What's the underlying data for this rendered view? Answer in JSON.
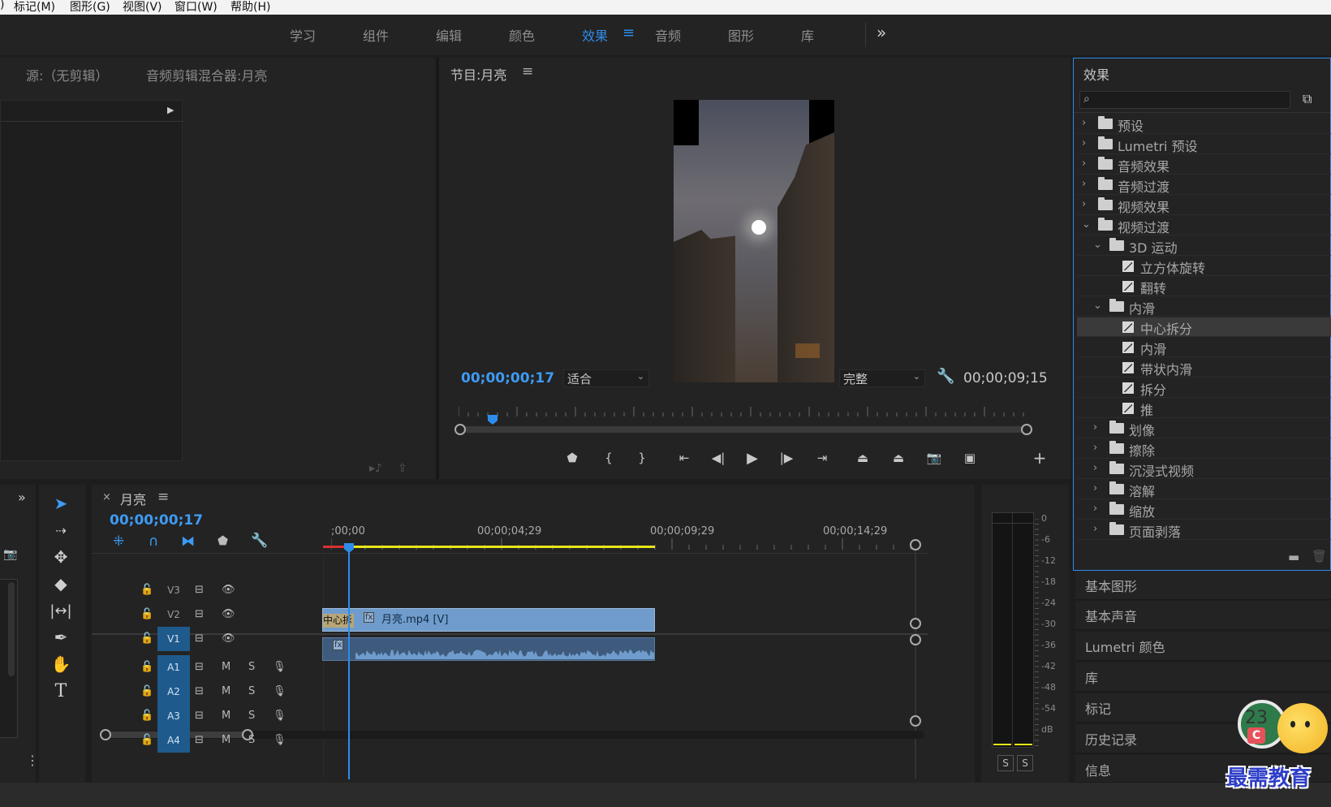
{
  "menu": {
    "items": [
      ")",
      "标记(M)",
      "图形(G)",
      "视图(V)",
      "窗口(W)",
      "帮助(H)"
    ]
  },
  "workspaces": {
    "tabs": [
      "学习",
      "组件",
      "编辑",
      "颜色",
      "效果",
      "音频",
      "图形",
      "库"
    ],
    "active": "效果",
    "more": "»"
  },
  "source_panel": {
    "tab_source": "源:（无剪辑）",
    "tab_mixer": "音频剪辑混合器:月亮"
  },
  "program": {
    "title": "节目:月亮",
    "timecode_current": "00;00;00;17",
    "fit_value": "适合",
    "quality_value": "完整",
    "timecode_duration": "00;00;09;15",
    "playhead_fraction": 0.06
  },
  "effects": {
    "title": "效果",
    "search_placeholder": "",
    "tree": [
      {
        "label": "预设",
        "level": 0,
        "kind": "preset",
        "expanded": false
      },
      {
        "label": "Lumetri 预设",
        "level": 0,
        "kind": "preset",
        "expanded": false
      },
      {
        "label": "音频效果",
        "level": 0,
        "kind": "folder",
        "expanded": false
      },
      {
        "label": "音频过渡",
        "level": 0,
        "kind": "folder",
        "expanded": false
      },
      {
        "label": "视频效果",
        "level": 0,
        "kind": "folder",
        "expanded": false
      },
      {
        "label": "视频过渡",
        "level": 0,
        "kind": "folder",
        "expanded": true
      },
      {
        "label": "3D 运动",
        "level": 1,
        "kind": "folder",
        "expanded": true
      },
      {
        "label": "立方体旋转",
        "level": 2,
        "kind": "effect"
      },
      {
        "label": "翻转",
        "level": 2,
        "kind": "effect"
      },
      {
        "label": "内滑",
        "level": 1,
        "kind": "folder",
        "expanded": true
      },
      {
        "label": "中心拆分",
        "level": 2,
        "kind": "effect",
        "selected": true
      },
      {
        "label": "内滑",
        "level": 2,
        "kind": "effect"
      },
      {
        "label": "带状内滑",
        "level": 2,
        "kind": "effect"
      },
      {
        "label": "拆分",
        "level": 2,
        "kind": "effect"
      },
      {
        "label": "推",
        "level": 2,
        "kind": "effect"
      },
      {
        "label": "划像",
        "level": 1,
        "kind": "folder",
        "expanded": false
      },
      {
        "label": "擦除",
        "level": 1,
        "kind": "folder",
        "expanded": false
      },
      {
        "label": "沉浸式视频",
        "level": 1,
        "kind": "folder",
        "expanded": false
      },
      {
        "label": "溶解",
        "level": 1,
        "kind": "folder",
        "expanded": false
      },
      {
        "label": "缩放",
        "level": 1,
        "kind": "folder",
        "expanded": false
      },
      {
        "label": "页面剥落",
        "level": 1,
        "kind": "folder",
        "expanded": false
      }
    ]
  },
  "side_panels": [
    "基本图形",
    "基本声音",
    "Lumetri 颜色",
    "库",
    "标记",
    "历史记录",
    "信息"
  ],
  "timeline": {
    "title": "月亮",
    "timecode": "00;00;00;17",
    "ruler": [
      ";00;00",
      "00;00;04;29",
      "00;00;09;29",
      "00;00;14;29"
    ],
    "tracks_video": [
      "V3",
      "V2",
      "V1"
    ],
    "tracks_audio": [
      "A1",
      "A2",
      "A3",
      "A4"
    ],
    "clip_video": "月亮.mp4 [V]",
    "transition_label": "中心拆",
    "mute": "M",
    "solo": "S"
  },
  "meter": {
    "scale": [
      "0",
      "-6",
      "-12",
      "-18",
      "-24",
      "-30",
      "-36",
      "-42",
      "-48",
      "-54",
      "dB"
    ],
    "solo_buttons": [
      "S",
      "S"
    ]
  },
  "watermark": {
    "text": "最需教育",
    "badge_number": "23",
    "badge_letter": "C"
  },
  "colors": {
    "accent": "#2d8ceb",
    "clip_video": "#6f9ccc",
    "clip_audio": "#3e5a7c",
    "work_area": "#e6e61a",
    "render_red": "#d83131"
  }
}
